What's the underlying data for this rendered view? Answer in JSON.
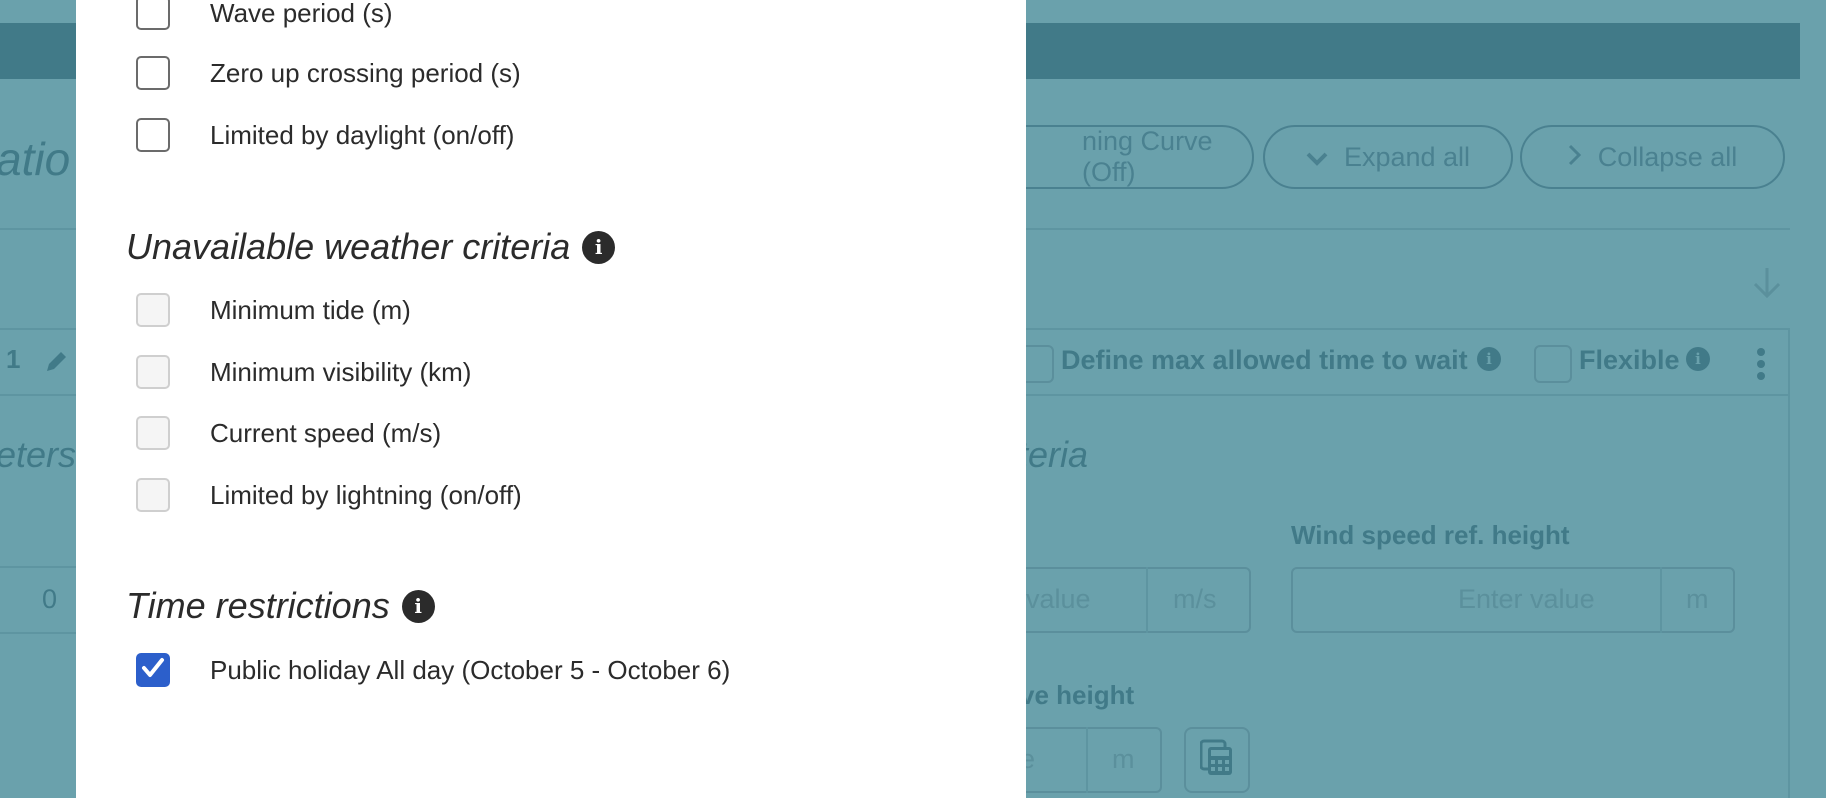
{
  "background": {
    "partial_heading": "atio",
    "row_number": "1",
    "partial_parameters": "eters",
    "value_zero": "0",
    "buttons": {
      "learning_curve": "ning Curve (Off)",
      "expand_all": "Expand all",
      "collapse_all": "Collapse all"
    },
    "task_bar": {
      "define_max_wait": "Define max allowed time to wait",
      "flexible": "Flexible"
    },
    "partial_criteria": "iteria",
    "wind_speed_ref_label": "Wind speed ref. height",
    "wind_speed_placeholder_partial": "value",
    "wind_speed_unit": "m/s",
    "wind_ref_placeholder": "Enter value",
    "wind_ref_unit": "m",
    "partial_wave_height_label": "ve height",
    "wave_height_placeholder_partial": "e",
    "wave_height_unit": "m"
  },
  "modal": {
    "weather_criteria": [
      {
        "label": "Wave period (s)",
        "checked": false
      },
      {
        "label": "Zero up crossing period (s)",
        "checked": false
      },
      {
        "label": "Limited by daylight (on/off)",
        "checked": false
      }
    ],
    "unavailable_section": {
      "title": "Unavailable weather criteria",
      "items": [
        {
          "label": "Minimum tide (m)",
          "checked": false,
          "disabled": true
        },
        {
          "label": "Minimum visibility (km)",
          "checked": false,
          "disabled": true
        },
        {
          "label": "Current speed (m/s)",
          "checked": false,
          "disabled": true
        },
        {
          "label": "Limited by lightning (on/off)",
          "checked": false,
          "disabled": true
        }
      ]
    },
    "time_section": {
      "title": "Time restrictions",
      "items": [
        {
          "label": "Public holiday All day (October 5 - October 6)",
          "checked": true
        }
      ]
    }
  },
  "colors": {
    "overlay": "#6aa1ac",
    "header": "#417a88",
    "checkbox_checked": "#2c5fcb"
  }
}
